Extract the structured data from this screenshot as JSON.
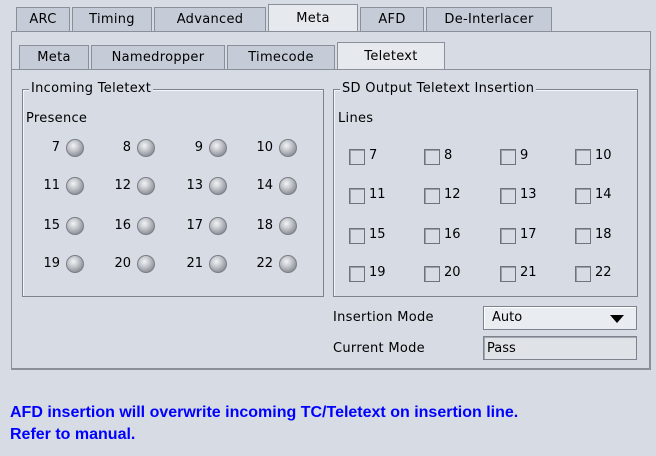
{
  "tabs_top": [
    {
      "label": "ARC"
    },
    {
      "label": "Timing"
    },
    {
      "label": "Advanced"
    },
    {
      "label": "Meta"
    },
    {
      "label": "AFD"
    },
    {
      "label": "De-Interlacer"
    }
  ],
  "tabs_sub": [
    {
      "label": "Meta"
    },
    {
      "label": "Namedropper"
    },
    {
      "label": "Timecode"
    },
    {
      "label": "Teletext"
    }
  ],
  "incoming": {
    "title": "Incoming Teletext",
    "presence_label": "Presence",
    "leds": [
      "7",
      "8",
      "9",
      "10",
      "11",
      "12",
      "13",
      "14",
      "15",
      "16",
      "17",
      "18",
      "19",
      "20",
      "21",
      "22"
    ]
  },
  "sd_output": {
    "title": "SD Output Teletext Insertion",
    "lines_label": "Lines",
    "lines": [
      "7",
      "8",
      "9",
      "10",
      "11",
      "12",
      "13",
      "14",
      "15",
      "16",
      "17",
      "18",
      "19",
      "20",
      "21",
      "22"
    ]
  },
  "insertion_mode": {
    "label": "Insertion Mode",
    "value": "Auto"
  },
  "current_mode": {
    "label": "Current Mode",
    "value": "Pass"
  },
  "note": {
    "line1": "AFD insertion will overwrite incoming TC/Teletext on insertion line.",
    "line2": "Refer to manual."
  }
}
